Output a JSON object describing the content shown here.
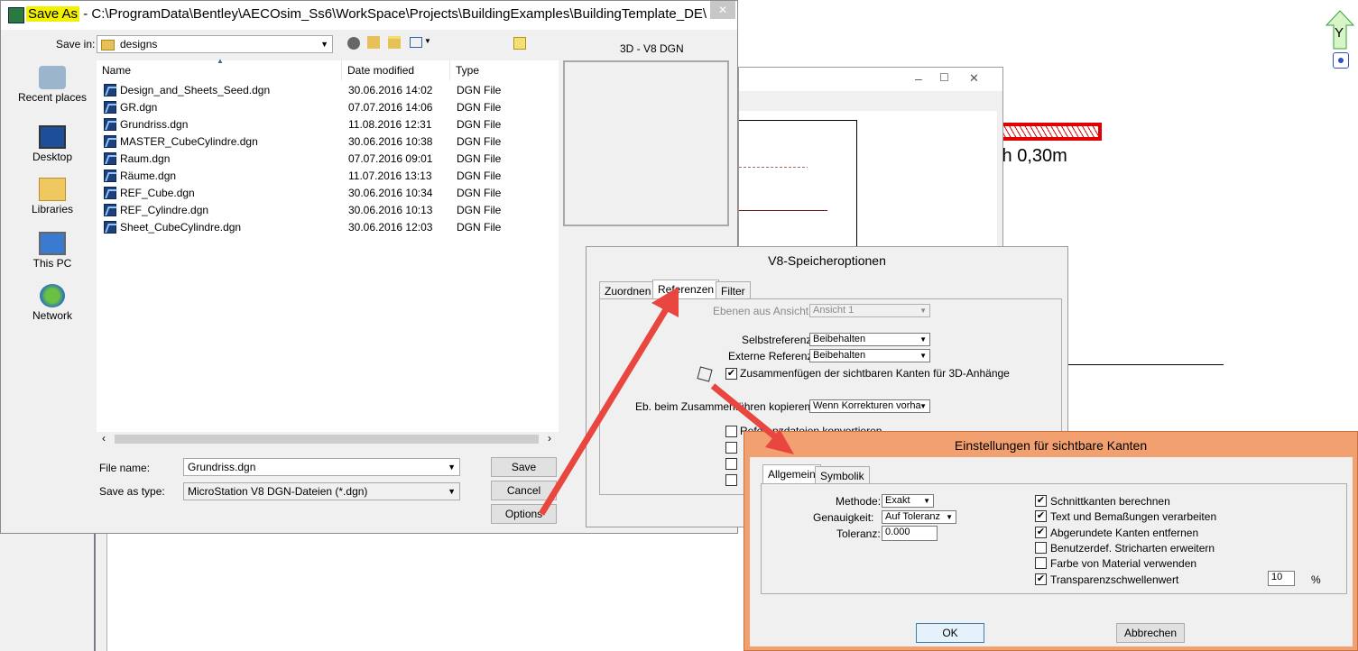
{
  "save_as": {
    "title_highlight": "Save As",
    "title_sep": " - ",
    "title_path": "C:\\ProgramData\\Bentley\\AECOsim_Ss6\\WorkSpace\\Projects\\BuildingExamples\\BuildingTemplate_DE\\",
    "close": "✕",
    "save_in_label": "Save in:",
    "save_in_value": "designs",
    "preview_label": "3D - V8 DGN",
    "places": [
      "Recent places",
      "Desktop",
      "Libraries",
      "This PC",
      "Network"
    ],
    "columns": [
      "Name",
      "Date modified",
      "Type"
    ],
    "files": [
      {
        "name": "Design_and_Sheets_Seed.dgn",
        "date": "30.06.2016 14:02",
        "type": "DGN File"
      },
      {
        "name": "GR.dgn",
        "date": "07.07.2016 14:06",
        "type": "DGN File"
      },
      {
        "name": "Grundriss.dgn",
        "date": "11.08.2016 12:31",
        "type": "DGN File"
      },
      {
        "name": "MASTER_CubeCylindre.dgn",
        "date": "30.06.2016 10:38",
        "type": "DGN File"
      },
      {
        "name": "Raum.dgn",
        "date": "07.07.2016 09:01",
        "type": "DGN File"
      },
      {
        "name": "Räume.dgn",
        "date": "11.07.2016 13:13",
        "type": "DGN File"
      },
      {
        "name": "REF_Cube.dgn",
        "date": "30.06.2016 10:34",
        "type": "DGN File"
      },
      {
        "name": "REF_Cylindre.dgn",
        "date": "30.06.2016 10:13",
        "type": "DGN File"
      },
      {
        "name": "Sheet_CubeCylindre.dgn",
        "date": "30.06.2016 12:03",
        "type": "DGN File"
      }
    ],
    "file_name_label": "File name:",
    "file_name_value": "Grundriss.dgn",
    "save_type_label": "Save as type:",
    "save_type_value": "MicroStation V8 DGN-Dateien (*.dgn)",
    "save_btn": "Save",
    "cancel_btn": "Cancel",
    "options_btn": "Options"
  },
  "background": {
    "text": "th 0,30m",
    "axis_label": "Y"
  },
  "v8_options": {
    "title": "V8-Speicheroptionen",
    "tabs": [
      "Zuordnen",
      "Referenzen",
      "Filter"
    ],
    "ebenen_label": "Ebenen aus Ansicht:",
    "ebenen_value": "Ansicht 1",
    "selbst_label": "Selbstreferenz",
    "selbst_value": "Beibehalten",
    "extern_label": "Externe Referenz",
    "extern_value": "Beibehalten",
    "zusammen_cb": "Zusammenfügen der sichtbaren Kanten für 3D-Anhänge",
    "eb_label": "Eb. beim Zusammenführen kopieren:",
    "eb_value": "Wenn Korrekturen vorha",
    "partial_cb": "Referenzdateien konvertieren"
  },
  "einstellungen": {
    "title": "Einstellungen für sichtbare Kanten",
    "tabs": [
      "Allgemein",
      "Symbolik"
    ],
    "methode_label": "Methode:",
    "methode_value": "Exakt",
    "genau_label": "Genauigkeit:",
    "genau_value": "Auf Toleranz",
    "toleranz_label": "Toleranz:",
    "toleranz_value": "0.000",
    "checks": [
      {
        "label": "Schnittkanten berechnen",
        "checked": true
      },
      {
        "label": "Text und Bemaßungen verarbeiten",
        "checked": true
      },
      {
        "label": "Abgerundete Kanten entfernen",
        "checked": true
      },
      {
        "label": "Benutzerdef. Stricharten erweitern",
        "checked": false
      },
      {
        "label": "Farbe von Material verwenden",
        "checked": false
      },
      {
        "label": "Transparenzschwellenwert",
        "checked": true
      }
    ],
    "transparenz_value": "10",
    "percent": "%",
    "ok_btn": "OK",
    "abbrechen_btn": "Abbrechen"
  },
  "colors": {
    "arrow": "#e8463e",
    "highlight": "#f2f200",
    "orange_frame": "#f3a070"
  }
}
